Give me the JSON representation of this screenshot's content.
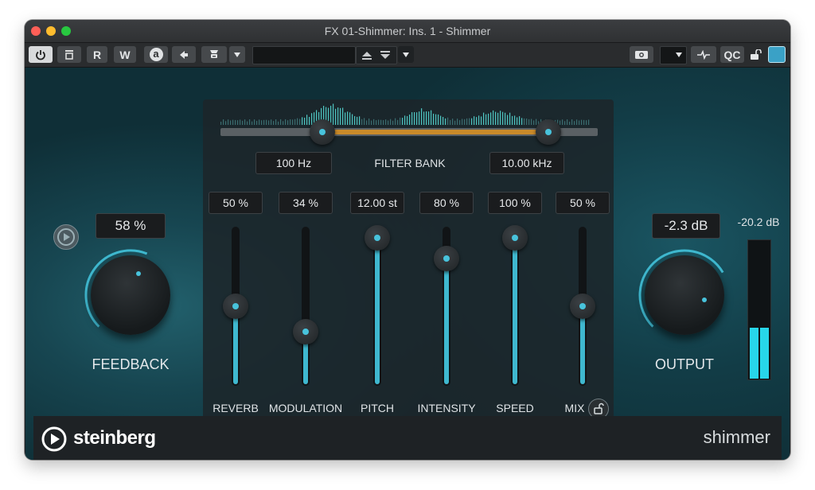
{
  "window": {
    "title": "FX 01-Shimmer: Ins. 1 - Shimmer"
  },
  "toolbar": {
    "r_label": "R",
    "w_label": "W",
    "a_label": "a",
    "qc_label": "QC",
    "preset_value": ""
  },
  "filter": {
    "low_value": "100 Hz",
    "high_value": "10.00 kHz",
    "label": "FILTER BANK",
    "low_fraction": 0.27,
    "high_fraction": 0.87
  },
  "feedback": {
    "value": "58 %",
    "label": "FEEDBACK",
    "level": 0.58
  },
  "output": {
    "value": "-2.3 dB",
    "label": "OUTPUT",
    "meter_value": "-20.2 dB",
    "meter_level": 0.37
  },
  "sliders": [
    {
      "label": "REVERB",
      "value": "50 %",
      "level": 0.5
    },
    {
      "label": "MODULATION",
      "value": "34 %",
      "level": 0.34
    },
    {
      "label": "PITCH",
      "value": "12.00 st",
      "level": 0.93
    },
    {
      "label": "INTENSITY",
      "value": "80 %",
      "level": 0.8
    },
    {
      "label": "SPEED",
      "value": "100 %",
      "level": 0.93
    },
    {
      "label": "MIX",
      "value": "50 %",
      "level": 0.5
    }
  ],
  "brand": {
    "name": "steinberg",
    "product": "shimmer"
  },
  "colors": {
    "accent": "#3fb8cf",
    "filter_range": "#c98a2a",
    "meter": "#27d6ea"
  }
}
